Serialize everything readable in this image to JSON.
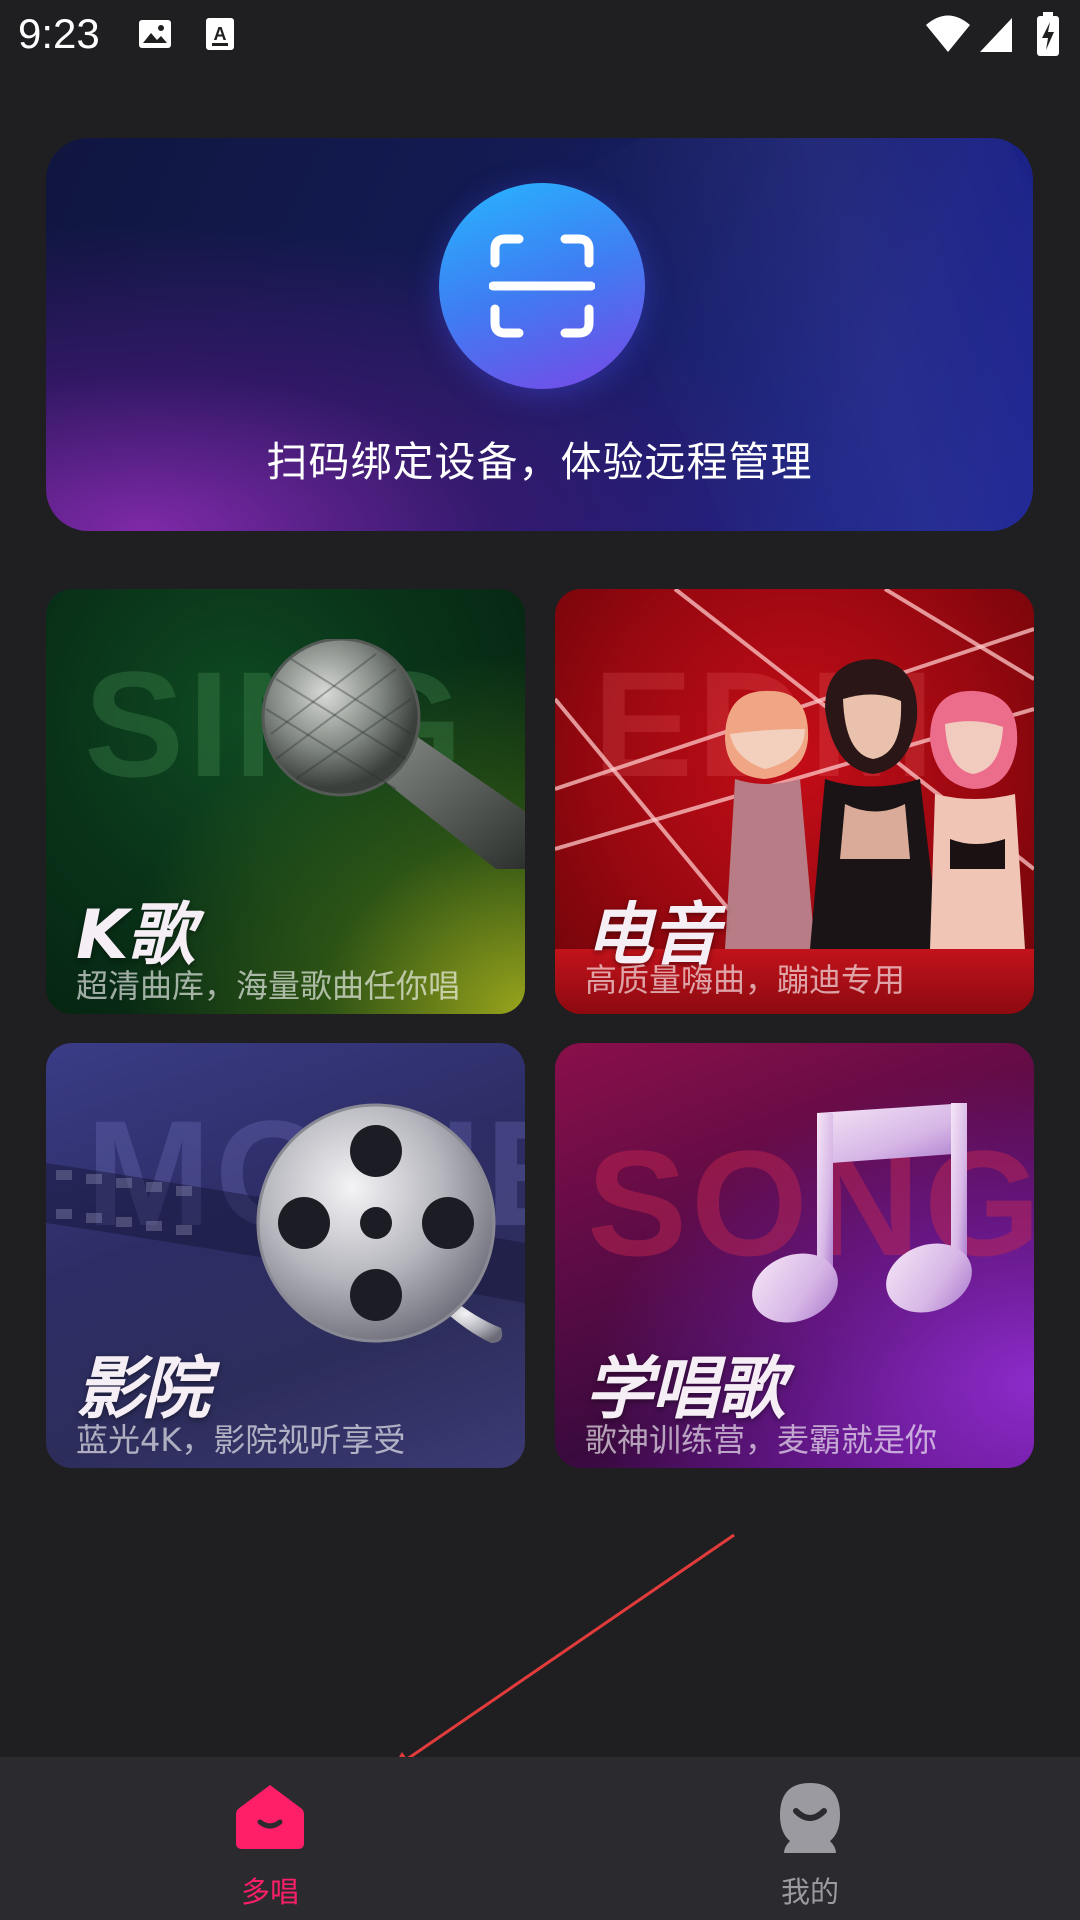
{
  "status_bar": {
    "time": "9:23",
    "icons": [
      "image-icon",
      "text-a-icon",
      "wifi-icon",
      "signal-icon",
      "battery-charging-icon"
    ]
  },
  "scan_banner": {
    "icon": "scan-icon",
    "text": "扫码绑定设备，体验远程管理"
  },
  "feature_cards": [
    {
      "id": "k-song",
      "title": "K歌",
      "subtitle": "超清曲库，海量歌曲任你唱",
      "bg_word": "SING",
      "icon": "microphone-icon",
      "accent": "#0b3a1a"
    },
    {
      "id": "edm",
      "title": "电音",
      "subtitle": "高质量嗨曲，蹦迪专用",
      "bg_word": "EDM",
      "icon": "dj-girls-image",
      "accent": "#b00a14"
    },
    {
      "id": "movie",
      "title": "影院",
      "subtitle": "蓝光4K，影院视听享受",
      "bg_word": "MOVIE",
      "icon": "film-reel-icon",
      "accent": "#30316c"
    },
    {
      "id": "learn-song",
      "title": "学唱歌",
      "subtitle": "歌神训练营，麦霸就是你",
      "bg_word": "SONG",
      "icon": "music-note-icon",
      "accent": "#6a0f5a"
    }
  ],
  "bottom_nav": {
    "items": [
      {
        "label": "多唱",
        "icon": "home-icon",
        "active": true,
        "color": "#ff1f68"
      },
      {
        "label": "我的",
        "icon": "profile-icon",
        "active": false,
        "color": "#9a9aa0"
      }
    ]
  }
}
